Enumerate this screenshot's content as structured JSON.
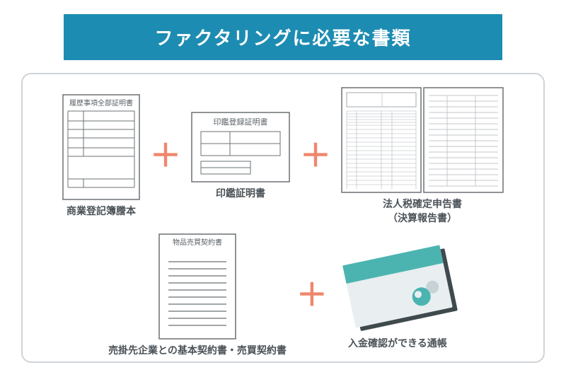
{
  "title": "ファクタリングに必要な書類",
  "documents": {
    "doc1": {
      "header": "履歴事項全部証明書",
      "caption": "商業登記簿謄本"
    },
    "doc2": {
      "header": "印鑑登録証明書",
      "caption": "印鑑証明書"
    },
    "doc3": {
      "caption_line1": "法人税確定申告書",
      "caption_line2": "（決算報告書）"
    },
    "doc4": {
      "header": "物品売買契約書",
      "caption": "売掛先企業との基本契約書・売買契約書"
    },
    "doc5": {
      "caption": "入金確認ができる通帳"
    }
  },
  "colors": {
    "accent": "#1d8cb2",
    "plus": "#f0866d",
    "teal": "#4bb4b0",
    "line": "#6b7075"
  }
}
